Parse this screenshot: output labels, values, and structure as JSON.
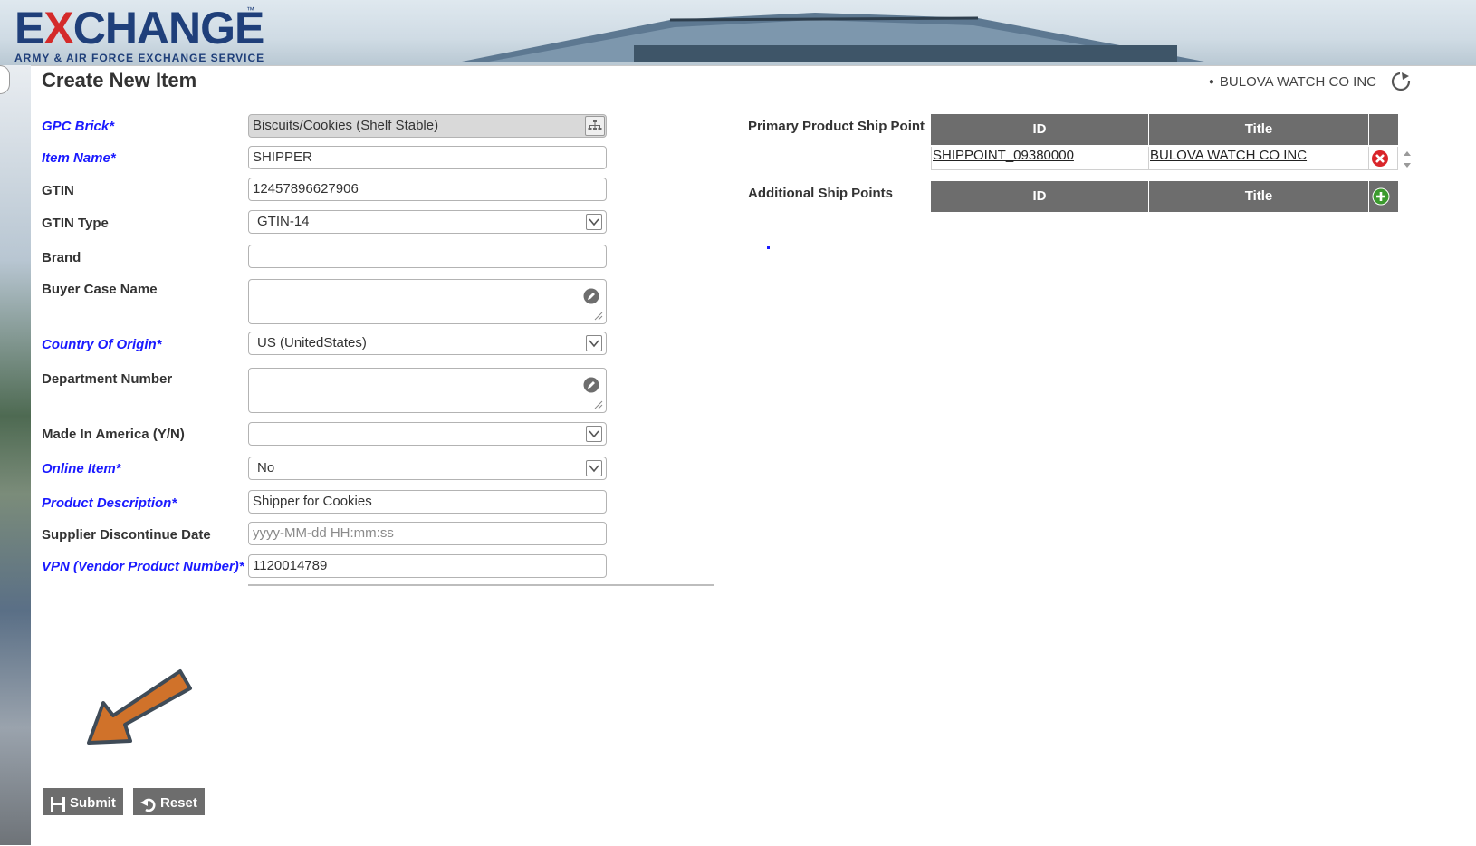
{
  "brand": {
    "logo_text": "EXCHANGE",
    "logo_trademark": "™",
    "logo_subtitle": "ARMY & AIR FORCE EXCHANGE SERVICE"
  },
  "header": {
    "page_title": "Create New Item",
    "organization": "BULOVA WATCH CO INC"
  },
  "form": {
    "gpc_brick": {
      "label": "GPC Brick*",
      "value": "Biscuits/Cookies (Shelf Stable)"
    },
    "item_name": {
      "label": "Item Name*",
      "value": "SHIPPER"
    },
    "gtin": {
      "label": "GTIN",
      "value": "12457896627906"
    },
    "gtin_type": {
      "label": "GTIN Type",
      "value": "GTIN-14"
    },
    "brand": {
      "label": "Brand",
      "value": ""
    },
    "buyer_case_name": {
      "label": "Buyer Case Name",
      "value": ""
    },
    "country_of_origin": {
      "label": "Country Of Origin*",
      "value": "US (UnitedStates)"
    },
    "department_number": {
      "label": "Department Number",
      "value": ""
    },
    "made_in_america": {
      "label": "Made In America (Y/N)",
      "value": ""
    },
    "online_item": {
      "label": "Online Item*",
      "value": "No"
    },
    "product_description": {
      "label": "Product Description*",
      "value": "Shipper for Cookies"
    },
    "supplier_discontinue_date": {
      "label": "Supplier Discontinue Date",
      "placeholder": "yyyy-MM-dd HH:mm:ss"
    },
    "vpn": {
      "label": "VPN (Vendor Product Number)*",
      "value": "1120014789"
    }
  },
  "ship_points": {
    "primary_label": "Primary Product Ship Point",
    "additional_label": "Additional Ship Points",
    "columns": {
      "id": "ID",
      "title": "Title"
    },
    "primary_rows": [
      {
        "id": "SHIPPOINT_09380000",
        "title": "BULOVA WATCH CO INC"
      }
    ]
  },
  "actions": {
    "submit_label": "Submit",
    "reset_label": "Reset"
  },
  "colors": {
    "required_label": "#1a1aff",
    "grid_header": "#6d6d6d",
    "remove_icon": "#d9252a",
    "add_icon": "#3c9a2e",
    "annotation_arrow": "#d0722a"
  }
}
